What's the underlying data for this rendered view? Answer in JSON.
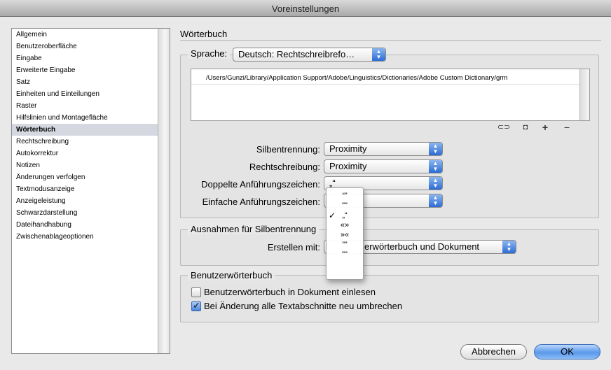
{
  "window": {
    "title": "Voreinstellungen"
  },
  "sidebar": {
    "items": [
      {
        "label": "Allgemein",
        "selected": false
      },
      {
        "label": "Benutzeroberfläche",
        "selected": false
      },
      {
        "label": "Eingabe",
        "selected": false
      },
      {
        "label": "Erweiterte Eingabe",
        "selected": false
      },
      {
        "label": "Satz",
        "selected": false
      },
      {
        "label": "Einheiten und Einteilungen",
        "selected": false
      },
      {
        "label": "Raster",
        "selected": false
      },
      {
        "label": "Hilfslinien und Montagefläche",
        "selected": false
      },
      {
        "label": "Wörterbuch",
        "selected": true
      },
      {
        "label": "Rechtschreibung",
        "selected": false
      },
      {
        "label": "Autokorrektur",
        "selected": false
      },
      {
        "label": "Notizen",
        "selected": false
      },
      {
        "label": "Änderungen verfolgen",
        "selected": false
      },
      {
        "label": "Textmodusanzeige",
        "selected": false
      },
      {
        "label": "Anzeigeleistung",
        "selected": false
      },
      {
        "label": "Schwarzdarstellung",
        "selected": false
      },
      {
        "label": "Dateihandhabung",
        "selected": false
      },
      {
        "label": "Zwischenablageoptionen",
        "selected": false
      }
    ]
  },
  "main": {
    "section_title": "Wörterbuch",
    "language": {
      "label": "Sprache:",
      "value": "Deutsch: Rechtschreibrefo…",
      "dictionary_path": "/Users/Gunzi/Library/Application Support/Adobe/Linguistics/Dictionaries/Adobe Custom Dictionary/grm"
    },
    "hyphenation": {
      "label": "Silbentrennung:",
      "value": "Proximity"
    },
    "spelling": {
      "label": "Rechtschreibung:",
      "value": "Proximity"
    },
    "double_quotes": {
      "label": "Doppelte Anführungszeichen:",
      "value": "„“",
      "options": [
        "“”",
        "\"\"",
        "„“",
        "«»",
        "»«",
        "””",
        "\"\""
      ],
      "checked_index": 2
    },
    "single_quotes": {
      "label": "Einfache Anführungszeichen:",
      "value": ""
    },
    "hyphenation_exceptions": {
      "group_label": "Ausnahmen für Silbentrennung",
      "create_label": "Erstellen mit:",
      "create_value": "erwörterbuch und Dokument"
    },
    "user_dictionary": {
      "group_label": "Benutzerwörterbuch",
      "read_into_doc": {
        "label": "Benutzerwörterbuch in Dokument einlesen",
        "checked": false
      },
      "recompose_all": {
        "label": "Bei Änderung alle Textabschnitte neu umbrechen",
        "checked": true
      }
    }
  },
  "buttons": {
    "cancel": "Abbrechen",
    "ok": "OK"
  },
  "colors": {
    "accent": "#3d7fe0",
    "selection": "#d5d8e0"
  }
}
